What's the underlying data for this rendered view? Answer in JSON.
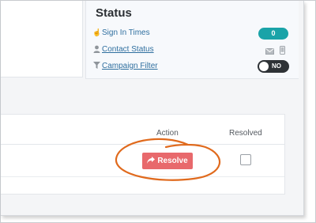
{
  "status_panel": {
    "title": "Status",
    "rows": [
      {
        "label": "Sign In Times",
        "icon": "pointer-hand-icon",
        "value": "0"
      },
      {
        "label": "Contact Status",
        "icon": "user-icon"
      },
      {
        "label": "Campaign Filter",
        "icon": "filter-icon",
        "toggle_label": "NO",
        "toggle_on": false
      }
    ]
  },
  "table": {
    "headers": {
      "action": "Action",
      "resolved": "Resolved"
    },
    "row": {
      "action_button": "Resolve",
      "resolved_checked": false
    }
  },
  "colors": {
    "accent_teal": "#1aa3a8",
    "resolve_red": "#e8696c",
    "annotation_orange": "#e06a1d",
    "link_blue": "#2f6f9f"
  }
}
